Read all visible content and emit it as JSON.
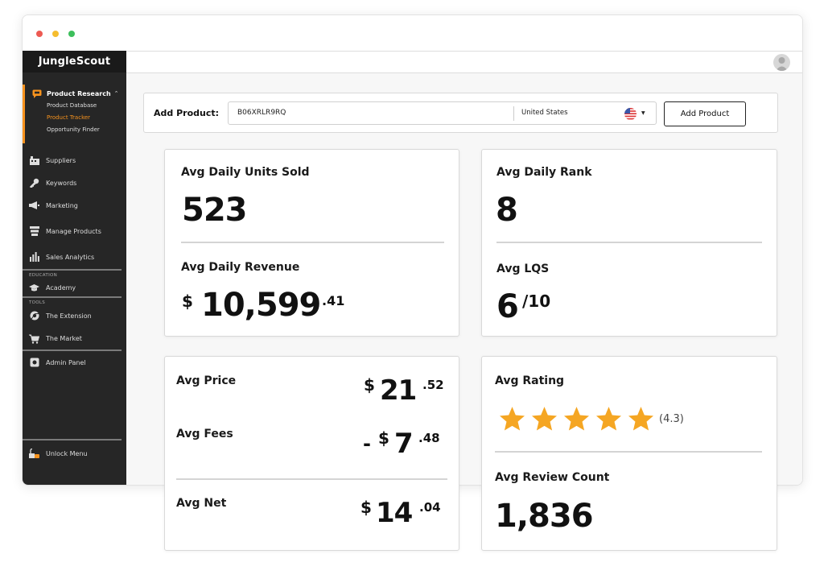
{
  "window": {
    "controls": [
      "close",
      "minimize",
      "maximize"
    ]
  },
  "sidebar": {
    "brand": "JungleScout",
    "product_research": {
      "label": "Product Research",
      "icon": "chat-bubble-icon",
      "items": [
        "Product Database",
        "Product Tracker",
        "Opportunity Finder"
      ],
      "active_item": "Product Tracker"
    },
    "nav": [
      {
        "label": "Suppliers",
        "icon": "suppliers-icon"
      },
      {
        "label": "Keywords",
        "icon": "key-icon"
      },
      {
        "label": "Marketing",
        "icon": "megaphone-icon"
      },
      {
        "label": "Manage Products",
        "icon": "stack-icon"
      },
      {
        "label": "Sales Analytics",
        "icon": "bar-chart-icon"
      }
    ],
    "education_label": "EDUCATION",
    "academy": "Academy",
    "tools_label": "TOOLS",
    "tools": [
      {
        "label": "The Extension",
        "icon": "chrome-icon"
      },
      {
        "label": "The Market",
        "icon": "cart-icon"
      }
    ],
    "admin": "Admin Panel",
    "unlock": "Unlock Menu"
  },
  "search": {
    "label": "Add Product:",
    "value": "B06XRLR9RQ",
    "country": "United States",
    "button": "Add Product"
  },
  "units": {
    "label": "Avg Daily Units Sold",
    "value": "523"
  },
  "revenue": {
    "label": "Avg Daily Revenue",
    "currency": "$",
    "whole": "10,599",
    "cents": ".41"
  },
  "rank": {
    "label": "Avg Daily Rank",
    "value": "8"
  },
  "lqs": {
    "label": "Avg LQS",
    "value": "6",
    "denom": "/10"
  },
  "price": {
    "label": "Avg Price",
    "currency": "$",
    "whole": "21",
    "cents": ".52"
  },
  "fees": {
    "label": "Avg Fees",
    "prefix": "-",
    "currency": "$",
    "whole": "7",
    "cents": ".48"
  },
  "net": {
    "label": "Avg Net",
    "currency": "$",
    "whole": "14",
    "cents": ".04"
  },
  "rating": {
    "label": "Avg Rating",
    "stars": 5,
    "value_text": "(4.3)",
    "star_color": "#f5a623"
  },
  "reviews": {
    "label": "Avg Review Count",
    "value": "1,836"
  },
  "colors": {
    "accent": "#f7931e",
    "sidebar_bg": "#262626"
  }
}
